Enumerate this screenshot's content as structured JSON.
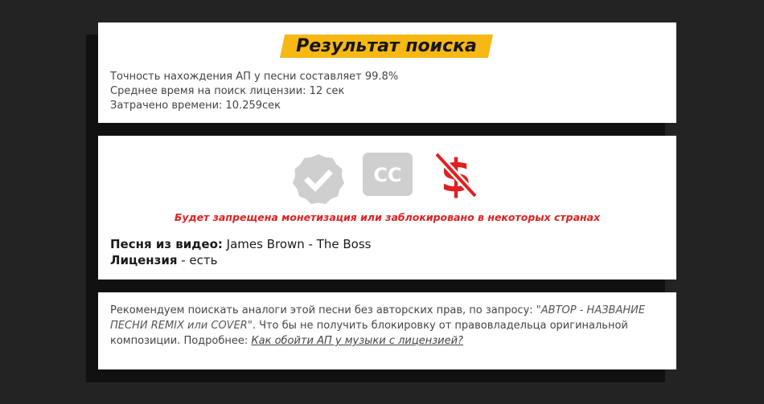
{
  "result": {
    "title": "Результат поиска",
    "stats": [
      "Точность нахождения АП у песни составляет 99.8%",
      "Среднее время на поиск лицензии: 12 сек",
      "Затрачено времени: 10.259сек"
    ]
  },
  "status": {
    "icons": [
      "verified-badge-icon",
      "closed-captions-icon",
      "no-monetization-icon"
    ],
    "cc_label": "CC",
    "warning": "Будет запрещена монетизация или заблокировано в некоторых странах",
    "song_label": "Песня из видео:",
    "song_value": " James Brown - The Boss",
    "license_label": "Лицензия",
    "license_value": " - есть"
  },
  "recommendation": {
    "text_before": "Рекомендуем поискать аналоги этой песни без авторских прав, по запросу: ",
    "query": "\"АВТОР - НАЗВАНИЕ ПЕСНИ REMIX или COVER\"",
    "text_after": ". Что бы не получить блокировку от правовладельца оригинальной композиции. Подробнее: ",
    "link": "Как обойти АП у музыки с лицензией?"
  },
  "colors": {
    "accent": "#f7b814",
    "warning": "#e02020",
    "icon_gray": "#cfcfcf",
    "background": "#232323"
  }
}
